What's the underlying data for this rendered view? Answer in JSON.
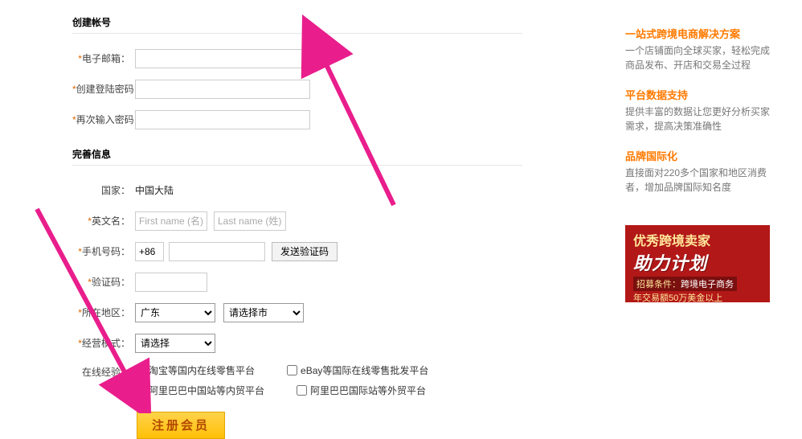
{
  "section1_title": "创建帐号",
  "section2_title": "完善信息",
  "labels": {
    "email": "电子邮箱",
    "password_create": "创建登陆密码",
    "password_again": "再次输入密码",
    "country": "国家",
    "en_name": "英文名",
    "mobile": "手机号码",
    "vcode": "验证码",
    "region": "所在地区",
    "biz_mode": "经营模式",
    "experience": "在线经验"
  },
  "country_value": "中国大陆",
  "placeholders": {
    "first_name": "First name (名)",
    "last_name": "Last name (姓)"
  },
  "phone_prefix": "+86",
  "sms_button": "发送验证码",
  "region_province_selected": "广东",
  "region_city_selected": "请选择市",
  "biz_mode_selected": "请选择",
  "checkboxes": {
    "cb1": "淘宝等国内在线零售平台",
    "cb2": "eBay等国际在线零售批发平台",
    "cb3": "阿里巴巴中国站等内贸平台",
    "cb4": "阿里巴巴国际站等外贸平台"
  },
  "register_button": "注册会员",
  "sidebar": {
    "items": [
      {
        "title": "一站式跨境电商解决方案",
        "desc": "一个店铺面向全球买家，轻松完成商品发布、开店和交易全过程"
      },
      {
        "title": "平台数据支持",
        "desc": "提供丰富的数据让您更好分析买家需求，提高决策准确性"
      },
      {
        "title": "品牌国际化",
        "desc": "直接面对220多个国家和地区消费者，增加品牌国际知名度"
      }
    ]
  },
  "promo": {
    "line1": "优秀跨境卖家",
    "line2": "助力计划",
    "sub1a": "招募条件：",
    "sub1b": "跨境电子商务",
    "sub2": "年交易额50万美金以上"
  }
}
